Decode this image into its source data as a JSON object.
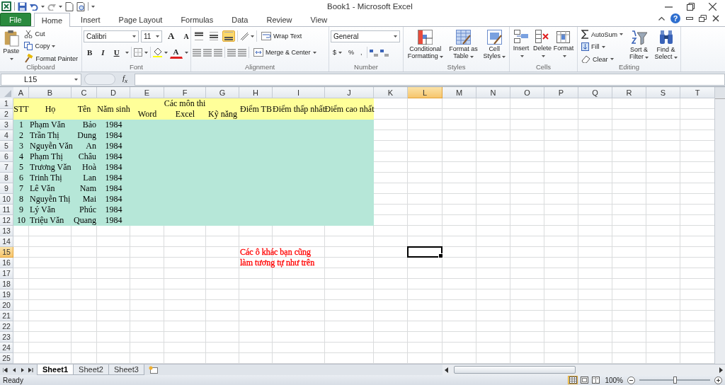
{
  "window": {
    "title": "Book1 - Microsoft Excel"
  },
  "ribbon_tabs": [
    {
      "label": "File",
      "kind": "file",
      "selected": false
    },
    {
      "label": "Home",
      "kind": "tab",
      "selected": true
    },
    {
      "label": "Insert",
      "kind": "tab",
      "selected": false
    },
    {
      "label": "Page Layout",
      "kind": "tab",
      "selected": false
    },
    {
      "label": "Formulas",
      "kind": "tab",
      "selected": false
    },
    {
      "label": "Data",
      "kind": "tab",
      "selected": false
    },
    {
      "label": "Review",
      "kind": "tab",
      "selected": false
    },
    {
      "label": "View",
      "kind": "tab",
      "selected": false
    }
  ],
  "help": "?",
  "ribbon": {
    "clipboard": {
      "label": "Clipboard",
      "paste": "Paste",
      "cut": "Cut",
      "copy": "Copy",
      "format_painter": "Format Painter"
    },
    "font": {
      "label": "Font",
      "font_name": "Calibri",
      "font_size": "11",
      "grow": "A",
      "shrink": "A",
      "bold": "B",
      "italic": "I",
      "underline": "U",
      "font_color": "A"
    },
    "alignment": {
      "label": "Alignment",
      "vertical_align": [
        {
          "selected": false
        },
        {
          "selected": false
        },
        {
          "selected": true
        }
      ],
      "wrap_text": "Wrap Text",
      "merge_center": "Merge & Center"
    },
    "number": {
      "label": "Number",
      "format": "General",
      "currency": "$",
      "percent": "%",
      "comma": ","
    },
    "styles": {
      "label": "Styles",
      "buttons": [
        "Conditional Formatting",
        "Format as Table",
        "Cell Styles"
      ]
    },
    "cells": {
      "label": "Cells",
      "buttons": [
        "Insert",
        "Delete",
        "Format"
      ]
    },
    "editing": {
      "label": "Editing",
      "autosum": "AutoSum",
      "fill": "Fill",
      "clear": "Clear",
      "sort_filter": "Sort & Filter",
      "find_select": "Find & Select"
    }
  },
  "formula_bar": {
    "name_box": "L15",
    "fx": "f$_{x}$"
  },
  "sheet": {
    "columns": [
      {
        "label": "A",
        "selected": false
      },
      {
        "label": "B",
        "selected": false
      },
      {
        "label": "C",
        "selected": false
      },
      {
        "label": "D",
        "selected": false
      },
      {
        "label": "E",
        "selected": false
      },
      {
        "label": "F",
        "selected": false
      },
      {
        "label": "G",
        "selected": false
      },
      {
        "label": "H",
        "selected": false
      },
      {
        "label": "I",
        "selected": false
      },
      {
        "label": "J",
        "selected": false
      },
      {
        "label": "K",
        "selected": false
      },
      {
        "label": "L",
        "selected": true
      },
      {
        "label": "M",
        "selected": false
      },
      {
        "label": "N",
        "selected": false
      },
      {
        "label": "O",
        "selected": false
      },
      {
        "label": "P",
        "selected": false
      },
      {
        "label": "Q",
        "selected": false
      },
      {
        "label": "R",
        "selected": false
      },
      {
        "label": "S",
        "selected": false
      },
      {
        "label": "T",
        "selected": false
      }
    ],
    "rows": [
      {
        "label": "1",
        "selected": false
      },
      {
        "label": "2",
        "selected": false
      },
      {
        "label": "3",
        "selected": false
      },
      {
        "label": "4",
        "selected": false
      },
      {
        "label": "5",
        "selected": false
      },
      {
        "label": "6",
        "selected": false
      },
      {
        "label": "7",
        "selected": false
      },
      {
        "label": "8",
        "selected": false
      },
      {
        "label": "9",
        "selected": false
      },
      {
        "label": "10",
        "selected": false
      },
      {
        "label": "11",
        "selected": false
      },
      {
        "label": "12",
        "selected": false
      },
      {
        "label": "13",
        "selected": false
      },
      {
        "label": "14",
        "selected": false
      },
      {
        "label": "15",
        "selected": true
      },
      {
        "label": "16",
        "selected": false
      },
      {
        "label": "17",
        "selected": false
      },
      {
        "label": "18",
        "selected": false
      },
      {
        "label": "19",
        "selected": false
      },
      {
        "label": "20",
        "selected": false
      },
      {
        "label": "21",
        "selected": false
      },
      {
        "label": "22",
        "selected": false
      },
      {
        "label": "23",
        "selected": false
      },
      {
        "label": "24",
        "selected": false
      },
      {
        "label": "25",
        "selected": false
      }
    ],
    "header": {
      "color": "#ffff99",
      "cells": [
        {
          "text": "STT"
        },
        {
          "text": "Họ"
        },
        {
          "text": "Tên"
        },
        {
          "text": "Năm sinh"
        },
        {
          "text": "Các môn thi",
          "children": [
            {
              "text": "Word"
            },
            {
              "text": "Excel"
            },
            {
              "text": "Kỹ năng"
            }
          ]
        },
        {
          "text": "Điểm TB"
        },
        {
          "text": "Điểm thấp nhất"
        },
        {
          "text": "Điểm cao nhất"
        }
      ]
    },
    "body": {
      "color": "#b6e7d8",
      "records": [
        [
          "1",
          "Phạm Văn",
          "Bảo",
          "1984"
        ],
        [
          "2",
          "Trần Thị",
          "Dung",
          "1984"
        ],
        [
          "3",
          "Nguyễn Văn",
          "An",
          "1984"
        ],
        [
          "4",
          "Phạm Thị",
          "Châu",
          "1984"
        ],
        [
          "5",
          "Trương Văn",
          "Hoà",
          "1984"
        ],
        [
          "6",
          "Trinh Thị",
          "Lan",
          "1984"
        ],
        [
          "7",
          "Lê Văn",
          "Nam",
          "1984"
        ],
        [
          "8",
          "Nguyễn Thị",
          "Mai",
          "1984"
        ],
        [
          "9",
          "Lý Văn",
          "Phúc",
          "1984"
        ],
        [
          "10",
          "Triệu Văn",
          "Quang",
          "1984"
        ]
      ]
    },
    "notes": [
      {
        "text": "Các ô khác bạn cũng",
        "color": "#ff0000"
      },
      {
        "text": "làm tương tự như trên",
        "color": "#ff0000"
      }
    ]
  },
  "sheet_tabs": [
    {
      "label": "Sheet1",
      "selected": true
    },
    {
      "label": "Sheet2",
      "selected": false
    },
    {
      "label": "Sheet3",
      "selected": false
    }
  ],
  "status_bar": {
    "status": "Ready",
    "views": [
      {
        "selected": true
      },
      {
        "selected": false
      },
      {
        "selected": false
      }
    ],
    "zoom": "100%",
    "zoom_slider": {
      "level": 0.5
    }
  }
}
